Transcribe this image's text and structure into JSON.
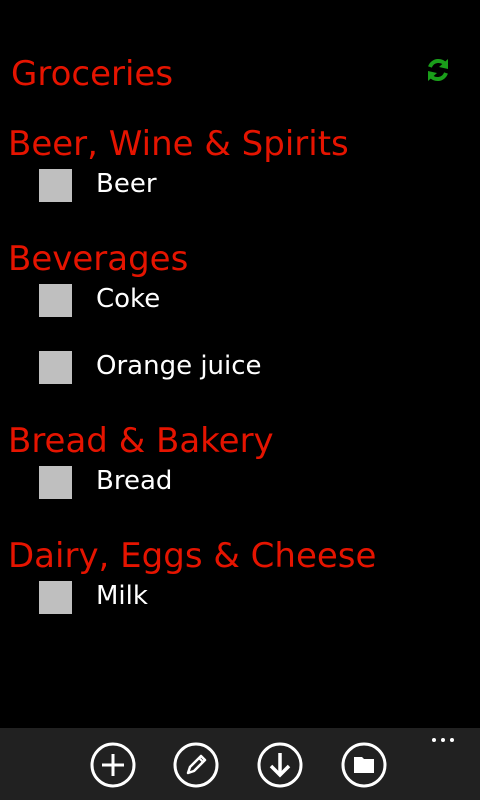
{
  "header": {
    "title": "Groceries"
  },
  "icons": {
    "sync": "sync-icon",
    "add": "add-icon",
    "edit": "edit-icon",
    "download": "download-icon",
    "folder": "folder-icon",
    "more": "more-icon"
  },
  "colors": {
    "accent": "#e51400",
    "sync_green": "#1a9e1a",
    "checkbox": "#bfbfbf",
    "app_bar": "#212121"
  },
  "categories": [
    {
      "name": "Beer, Wine & Spirits",
      "items": [
        {
          "label": "Beer",
          "checked": false
        }
      ]
    },
    {
      "name": "Beverages",
      "items": [
        {
          "label": "Coke",
          "checked": false
        },
        {
          "label": "Orange juice",
          "checked": false
        }
      ]
    },
    {
      "name": "Bread & Bakery",
      "items": [
        {
          "label": "Bread",
          "checked": false
        }
      ]
    },
    {
      "name": "Dairy, Eggs & Cheese",
      "items": [
        {
          "label": "Milk",
          "checked": false
        }
      ]
    }
  ]
}
